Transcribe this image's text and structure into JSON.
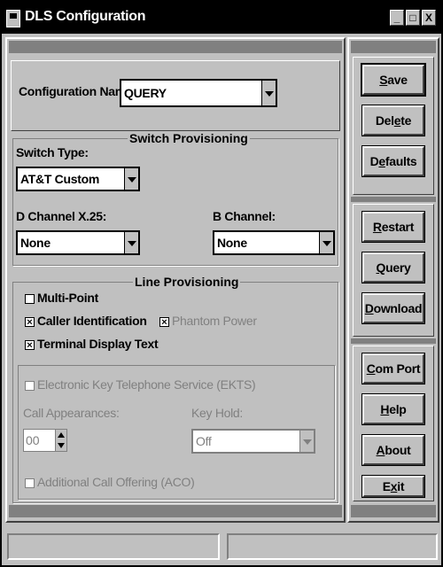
{
  "window": {
    "title": "DLS Configuration",
    "controls": [
      "_",
      "□",
      "X"
    ]
  },
  "config": {
    "name_label": "Configuration Name:",
    "name_value": "QUERY"
  },
  "switch_prov": {
    "title": "Switch Provisioning",
    "switch_type_label": "Switch Type:",
    "switch_type_value": "AT&T Custom",
    "dchannel_label": "D Channel X.25:",
    "dchannel_value": "None",
    "bchannel_label": "B Channel:",
    "bchannel_value": "None"
  },
  "line_prov": {
    "title": "Line Provisioning",
    "multipoint_label": "Multi-Point",
    "multipoint_checked": false,
    "caller_id_label": "Caller Identification",
    "caller_id_checked": true,
    "phantom_label": "Phantom Power",
    "phantom_checked": true,
    "terminal_label": "Terminal Display Text",
    "terminal_checked": true,
    "ekts_label": "Electronic Key Telephone Service (EKTS)",
    "call_app_label": "Call Appearances:",
    "call_app_value": "00",
    "key_hold_label": "Key Hold:",
    "key_hold_value": "Off",
    "aco_label": "Additional Call Offering (ACO)"
  },
  "buttons": {
    "save": {
      "u": "S",
      "rest": "ave"
    },
    "delete": {
      "pre": "Del",
      "u": "e",
      "rest": "te"
    },
    "defaults": {
      "pre": "D",
      "u": "e",
      "rest": "faults"
    },
    "restart": {
      "u": "R",
      "rest": "estart"
    },
    "query": {
      "u": "Q",
      "rest": "uery"
    },
    "download": {
      "u": "D",
      "rest": "ownload"
    },
    "comport": {
      "u": "C",
      "rest": "om Port"
    },
    "help": {
      "u": "H",
      "rest": "elp"
    },
    "about": {
      "u": "A",
      "rest": "bout"
    },
    "exit": {
      "pre": "E",
      "u": "x",
      "rest": "it"
    }
  },
  "colors": {
    "face": "#c0c0c0",
    "shadow": "#808080",
    "titlebar": "#000000",
    "disabled_text": "#808080"
  }
}
